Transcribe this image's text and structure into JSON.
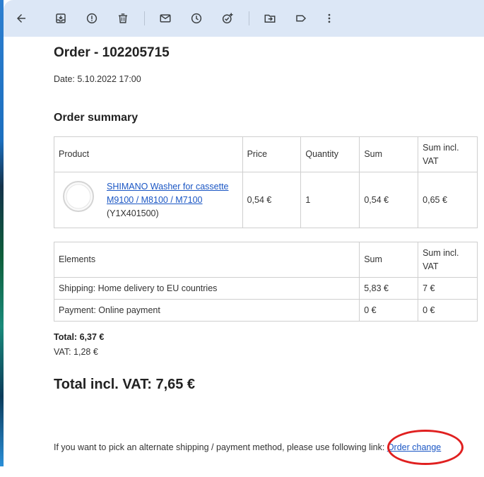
{
  "order": {
    "title": "Order - 102205715",
    "date": "Date: 5.10.2022 17:00",
    "summary_title": "Order summary"
  },
  "products_table": {
    "headers": [
      "Product",
      "Price",
      "Quantity",
      "Sum",
      "Sum incl. VAT"
    ],
    "rows": [
      {
        "name": "SHIMANO Washer for cassette M9100 / M8100 / M7100",
        "code": "(Y1X401500)",
        "price": "0,54 €",
        "quantity": "1",
        "sum": "0,54 €",
        "sum_incl_vat": "0,65 €"
      }
    ]
  },
  "elements_table": {
    "headers": [
      "Elements",
      "Sum",
      "Sum incl. VAT"
    ],
    "rows": [
      {
        "label": "Shipping: Home delivery to EU countries",
        "sum": "5,83 €",
        "sum_incl_vat": "7 €"
      },
      {
        "label": "Payment: Online payment",
        "sum": "0 €",
        "sum_incl_vat": "0 €"
      }
    ]
  },
  "totals": {
    "total": "Total: 6,37 €",
    "vat": "VAT: 1,28 €",
    "grand_total": "Total incl. VAT: 7,65 €"
  },
  "footer": {
    "text": "If you want to pick an alternate shipping / payment method, please use following link: ",
    "link": "Order change"
  },
  "toolbar": {
    "icons": [
      "back-arrow-icon",
      "archive-icon",
      "report-spam-icon",
      "delete-icon",
      "mark-unread-icon",
      "snooze-icon",
      "add-task-icon",
      "move-to-icon",
      "label-icon",
      "more-icon"
    ]
  },
  "colors": {
    "toolbar_bg": "#dce7f6",
    "link": "#1a56c4",
    "annotation": "#e02020"
  }
}
